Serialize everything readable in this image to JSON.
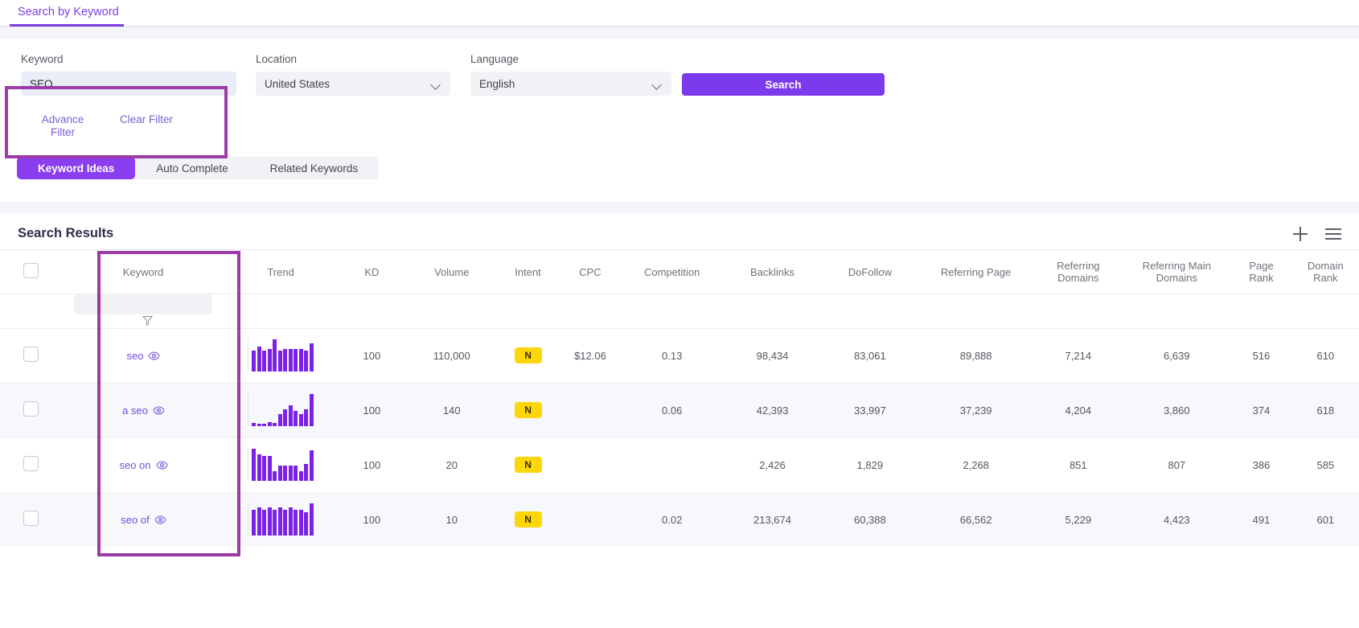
{
  "tabstrip": {
    "items": [
      {
        "label": "Search by Keyword"
      }
    ]
  },
  "search_form": {
    "keyword": {
      "label": "Keyword",
      "value": "SEO",
      "placeholder": ""
    },
    "location": {
      "label": "Location",
      "value": "United States"
    },
    "language": {
      "label": "Language",
      "value": "English"
    },
    "search_button": "Search"
  },
  "filters": {
    "advance_filter": "Advance Filter",
    "clear_filter": "Clear Filter"
  },
  "tabs": [
    {
      "label": "Keyword Ideas",
      "active": true
    },
    {
      "label": "Auto Complete",
      "active": false
    },
    {
      "label": "Related Keywords",
      "active": false
    }
  ],
  "results": {
    "title": "Search Results",
    "columns": [
      "Keyword",
      "Trend",
      "KD",
      "Volume",
      "Intent",
      "CPC",
      "Competition",
      "Backlinks",
      "DoFollow",
      "Referring Page",
      "Referring Domains",
      "Referring Main Domains",
      "Page Rank",
      "Domain Rank"
    ],
    "column_lines": {
      "referring_domains": [
        "Referring",
        "Domains"
      ],
      "referring_main_domains": [
        "Referring Main",
        "Domains"
      ],
      "page_rank": [
        "Page",
        "Rank"
      ],
      "domain_rank": [
        "Domain",
        "Rank"
      ]
    },
    "filter_row": {
      "keyword_filter_value": ""
    },
    "rows": [
      {
        "keyword": "seo",
        "kd": "100",
        "volume": "110,000",
        "intent": "N",
        "cpc": "$12.06",
        "competition": "0.13",
        "backlinks": "98,434",
        "dofollow": "83,061",
        "referring_page": "89,888",
        "referring_domains": "7,214",
        "referring_main_domains": "6,639",
        "page_rank": "516",
        "domain_rank": "610",
        "trend": [
          22,
          26,
          22,
          24,
          34,
          22,
          24,
          24,
          24,
          24,
          22,
          30
        ]
      },
      {
        "keyword": "a seo",
        "kd": "100",
        "volume": "140",
        "intent": "N",
        "cpc": "",
        "competition": "0.06",
        "backlinks": "42,393",
        "dofollow": "33,997",
        "referring_page": "37,239",
        "referring_domains": "4,204",
        "referring_main_domains": "3,860",
        "page_rank": "374",
        "domain_rank": "618",
        "trend": [
          4,
          2,
          3,
          5,
          4,
          14,
          20,
          25,
          18,
          14,
          20,
          38
        ]
      },
      {
        "keyword": "seo on",
        "kd": "100",
        "volume": "20",
        "intent": "N",
        "cpc": "",
        "competition": "",
        "backlinks": "2,426",
        "dofollow": "1,829",
        "referring_page": "2,268",
        "referring_domains": "851",
        "referring_main_domains": "807",
        "page_rank": "386",
        "domain_rank": "585",
        "trend": [
          34,
          28,
          26,
          26,
          10,
          16,
          16,
          16,
          16,
          10,
          18,
          32
        ]
      },
      {
        "keyword": "seo of",
        "kd": "100",
        "volume": "10",
        "intent": "N",
        "cpc": "",
        "competition": "0.02",
        "backlinks": "213,674",
        "dofollow": "60,388",
        "referring_page": "66,562",
        "referring_domains": "5,229",
        "referring_main_domains": "4,423",
        "page_rank": "491",
        "domain_rank": "601",
        "trend": [
          24,
          26,
          24,
          26,
          24,
          26,
          24,
          26,
          24,
          24,
          22,
          30
        ]
      }
    ]
  },
  "colors": {
    "accent": "#7c3aed",
    "highlight": "#9c3ba5",
    "badge": "#ffd60a",
    "spark": "#7c22e8"
  }
}
